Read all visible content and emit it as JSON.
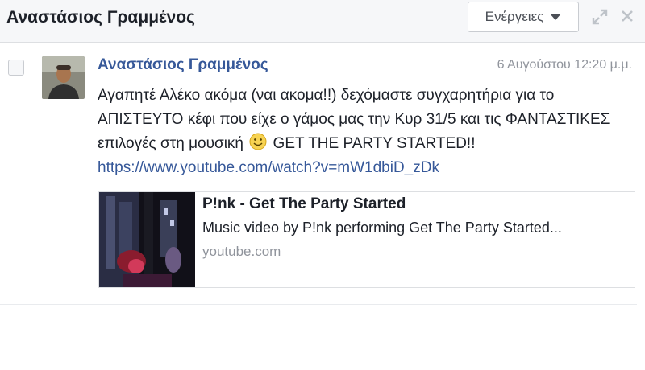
{
  "header": {
    "title": "Αναστάσιος Γραμμένος",
    "actions_label": "Ενέργειες",
    "icons": [
      "expand-icon",
      "close-icon"
    ]
  },
  "message": {
    "sender": "Αναστάσιος Γραμμένος",
    "timestamp": "6 Αυγούστου 12:20 μ.μ.",
    "text_before_emoji": "Αγαπητέ Αλέκο ακόμα (ναι ακομα!!) δεχόμαστε συγχαρητήρια για το ΑΠΙΣΤΕΥΤΟ κέφι που είχε ο γάμος μας την Κυρ 31/5 και τις ΦΑΝΤΑΣΤΙΚΕΣ επιλογές στη μουσική",
    "emoji": "smiley-icon",
    "text_after_emoji": "GET THE PARTY STARTED!!",
    "link": "https://www.youtube.com/watch?v=mW1dbiD_zDk"
  },
  "preview": {
    "title": "P!nk - Get The Party Started",
    "description": "Music video by P!nk performing Get The Party Started...",
    "domain": "youtube.com"
  },
  "colors": {
    "link": "#365899",
    "text": "#1d2129",
    "muted": "#90949c",
    "header_bg": "#f6f7f9"
  }
}
